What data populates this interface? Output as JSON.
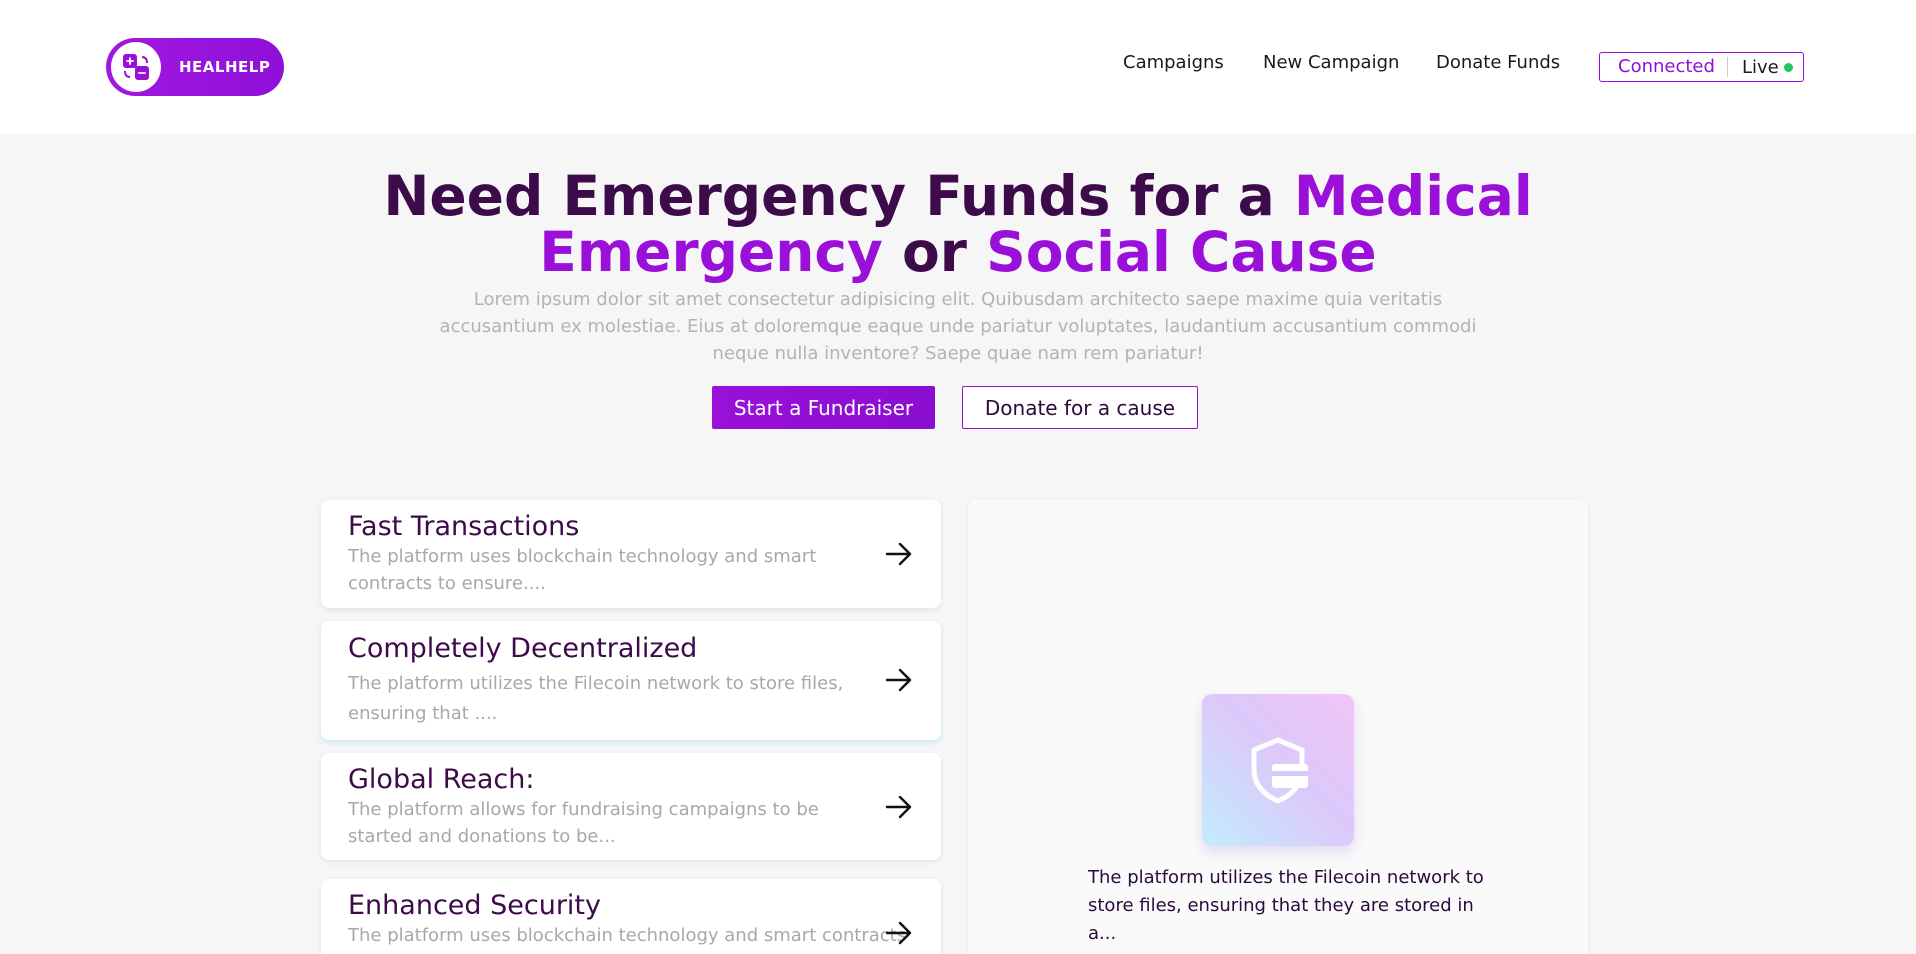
{
  "brand": {
    "name": "HEALHELP"
  },
  "nav": {
    "items": [
      "Campaigns",
      "New Campaign",
      "Donate Funds"
    ],
    "status_connected": "Connected",
    "status_live": "Live"
  },
  "hero": {
    "title_part1": "Need Emergency Funds for a ",
    "title_accent1": "Medical Emergency",
    "title_part2": " or ",
    "title_accent2": "Social Cause",
    "description": "Lorem ipsum dolor sit amet consectetur adipisicing elit. Quibusdam architecto saepe maxime quia veritatis accusantium ex molestiae. Eius at doloremque eaque unde pariatur voluptates, laudantium accusantium commodi neque nulla inventore? Saepe quae nam rem pariatur!",
    "primary_button": "Start a Fundraiser",
    "secondary_button": "Donate for a cause"
  },
  "features": [
    {
      "title": "Fast Transactions",
      "description": "The platform uses blockchain technology and smart contracts to ensure...."
    },
    {
      "title": "Completely Decentralized",
      "description": "The platform utilizes the Filecoin network to store files, ensuring that ...."
    },
    {
      "title": "Global Reach:",
      "description": "The platform allows for fundraising campaigns to be started and donations to be..."
    },
    {
      "title": "Enhanced Security",
      "description": "The platform uses blockchain technology and smart contracts"
    }
  ],
  "detail_panel": {
    "icon": "shield-card-icon",
    "text": "The platform utilizes the Filecoin network to store files, ensuring that they are stored in a..."
  },
  "colors": {
    "accent": "#9a10d8",
    "title": "#3d0a4a",
    "live_dot": "#22c55e"
  }
}
